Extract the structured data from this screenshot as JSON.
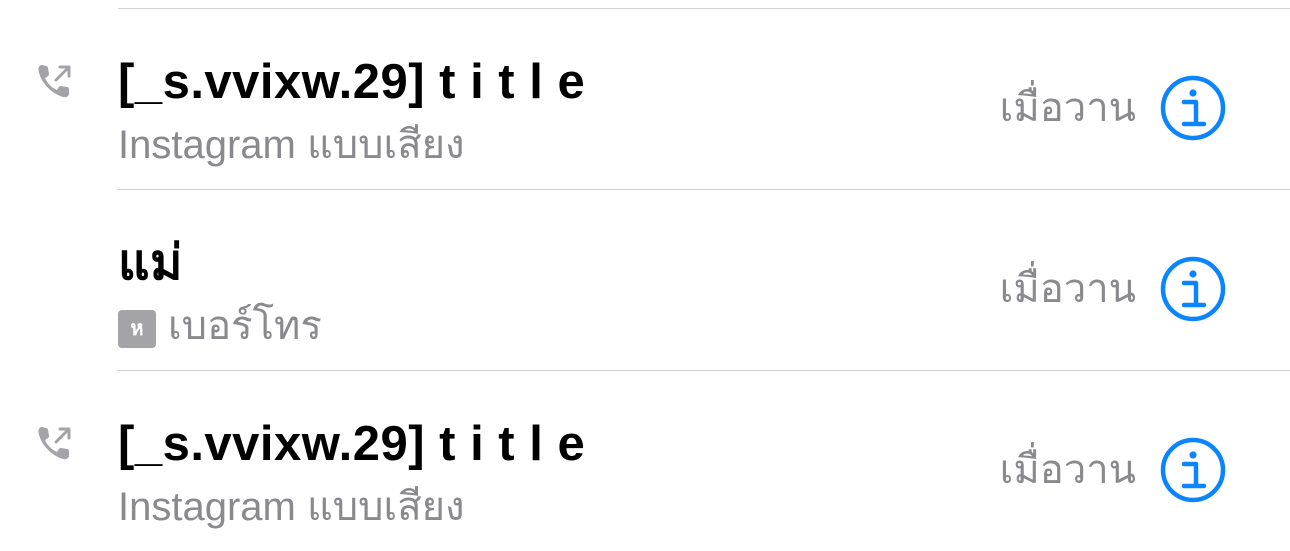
{
  "recents": [
    {
      "name": "[_s.vvixw.29] t i t l e",
      "type": "Instagram แบบเสียง",
      "badge": "",
      "time": "เมื่อวาน",
      "icon": "outgoing-call-icon"
    },
    {
      "name": "แม่",
      "type": "เบอร์โทร",
      "badge": "ห",
      "time": "เมื่อวาน",
      "icon": ""
    },
    {
      "name": "[_s.vvixw.29] t i t l e",
      "type": "Instagram แบบเสียง",
      "badge": "",
      "time": "เมื่อวาน",
      "icon": "outgoing-call-icon"
    }
  ],
  "colors": {
    "accent": "#0a84ff",
    "secondary_text": "#8a8a8e",
    "divider": "#d1d1d6",
    "icon_gray": "#a3a3a8"
  }
}
